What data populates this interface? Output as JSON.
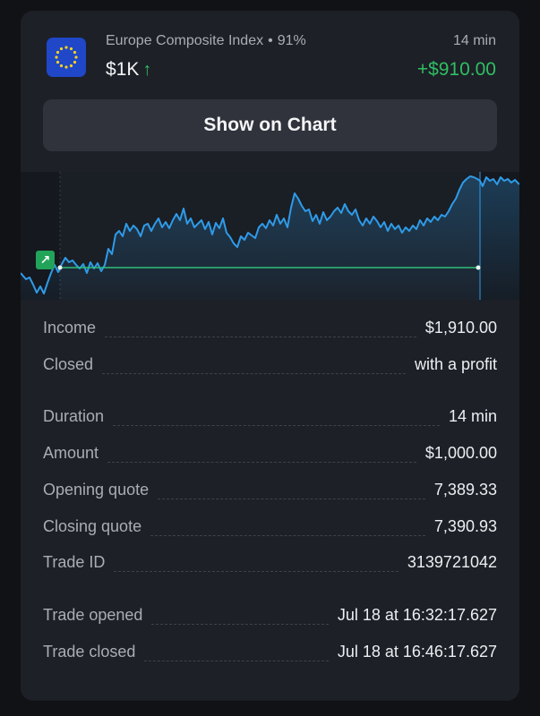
{
  "header": {
    "asset_name": "Europe Composite Index",
    "separator": "•",
    "payout": "91%",
    "amount": "$1K",
    "direction_arrow": "↑",
    "duration": "14 min",
    "profit": "+$910.00",
    "flag_icon": "eu-flag-icon"
  },
  "show_on_chart_label": "Show on Chart",
  "chart": {
    "marker_icon": "arrow-up-right-icon",
    "marker_glyph": "↗",
    "line_color": "#2f9be8",
    "strike_line_color": "#2fbf7a"
  },
  "details": {
    "rows": [
      {
        "label": "Income",
        "value": "$1,910.00"
      },
      {
        "label": "Closed",
        "value": "with a profit"
      },
      {
        "label": "Duration",
        "value": "14 min"
      },
      {
        "label": "Amount",
        "value": "$1,000.00"
      },
      {
        "label": "Opening quote",
        "value": "7,389.33"
      },
      {
        "label": "Closing quote",
        "value": "7,390.93"
      },
      {
        "label": "Trade ID",
        "value": "3139721042"
      },
      {
        "label": "Trade opened",
        "value": "Jul 18 at 16:32:17.627"
      },
      {
        "label": "Trade closed",
        "value": "Jul 18 at 16:46:17.627"
      }
    ]
  },
  "colors": {
    "profit_green": "#2fbf62",
    "card_bg": "#1d2027",
    "button_bg": "#30333b"
  }
}
